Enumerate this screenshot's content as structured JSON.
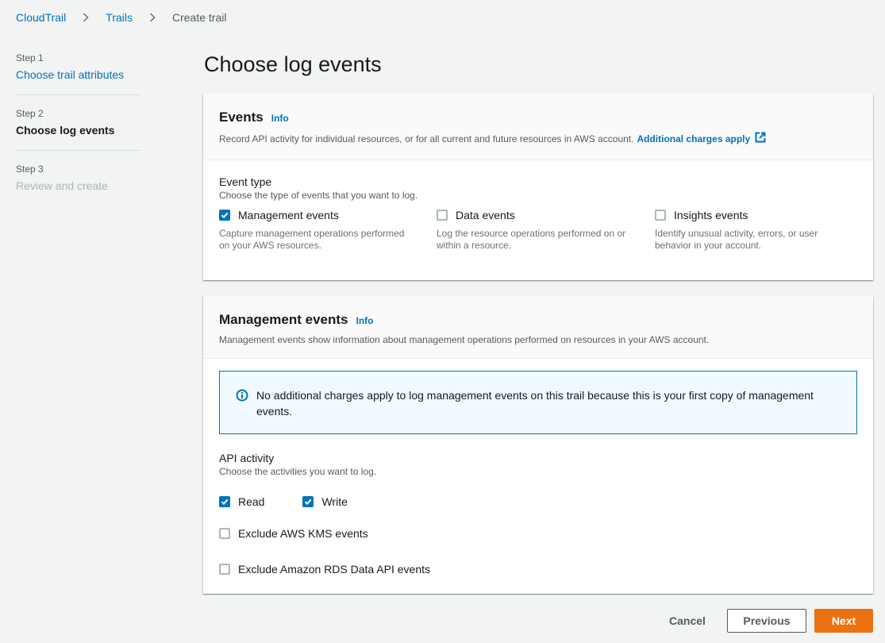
{
  "breadcrumb": {
    "items": [
      "CloudTrail",
      "Trails",
      "Create trail"
    ]
  },
  "steps": [
    {
      "number": "Step 1",
      "title": "Choose trail attributes",
      "state": "link"
    },
    {
      "number": "Step 2",
      "title": "Choose log events",
      "state": "active"
    },
    {
      "number": "Step 3",
      "title": "Review and create",
      "state": "disabled"
    }
  ],
  "page_title": "Choose log events",
  "events_panel": {
    "title": "Events",
    "info": "Info",
    "description": "Record API activity for individual resources, or for all current and future resources in AWS account.",
    "charges_link": "Additional charges apply",
    "event_type_label": "Event type",
    "event_type_desc": "Choose the type of events that you want to log.",
    "options": [
      {
        "label": "Management events",
        "desc": "Capture management operations performed on your AWS resources.",
        "checked": true
      },
      {
        "label": "Data events",
        "desc": "Log the resource operations performed on or within a resource.",
        "checked": false
      },
      {
        "label": "Insights events",
        "desc": "Identify unusual activity, errors, or user behavior in your account.",
        "checked": false
      }
    ]
  },
  "mgmt_panel": {
    "title": "Management events",
    "info": "Info",
    "description": "Management events show information about management operations performed on resources in your AWS account.",
    "alert": "No additional charges apply to log management events on this trail because this is your first copy of management events.",
    "api_label": "API activity",
    "api_desc": "Choose the activities you want to log.",
    "read_label": "Read",
    "read_checked": true,
    "write_label": "Write",
    "write_checked": true,
    "kms_label": "Exclude AWS KMS events",
    "kms_checked": false,
    "rds_label": "Exclude Amazon RDS Data API events",
    "rds_checked": false
  },
  "buttons": {
    "cancel": "Cancel",
    "previous": "Previous",
    "next": "Next"
  },
  "colors": {
    "link": "#0073bb",
    "primary_button": "#ec7211",
    "background": "#f2f3f3"
  }
}
